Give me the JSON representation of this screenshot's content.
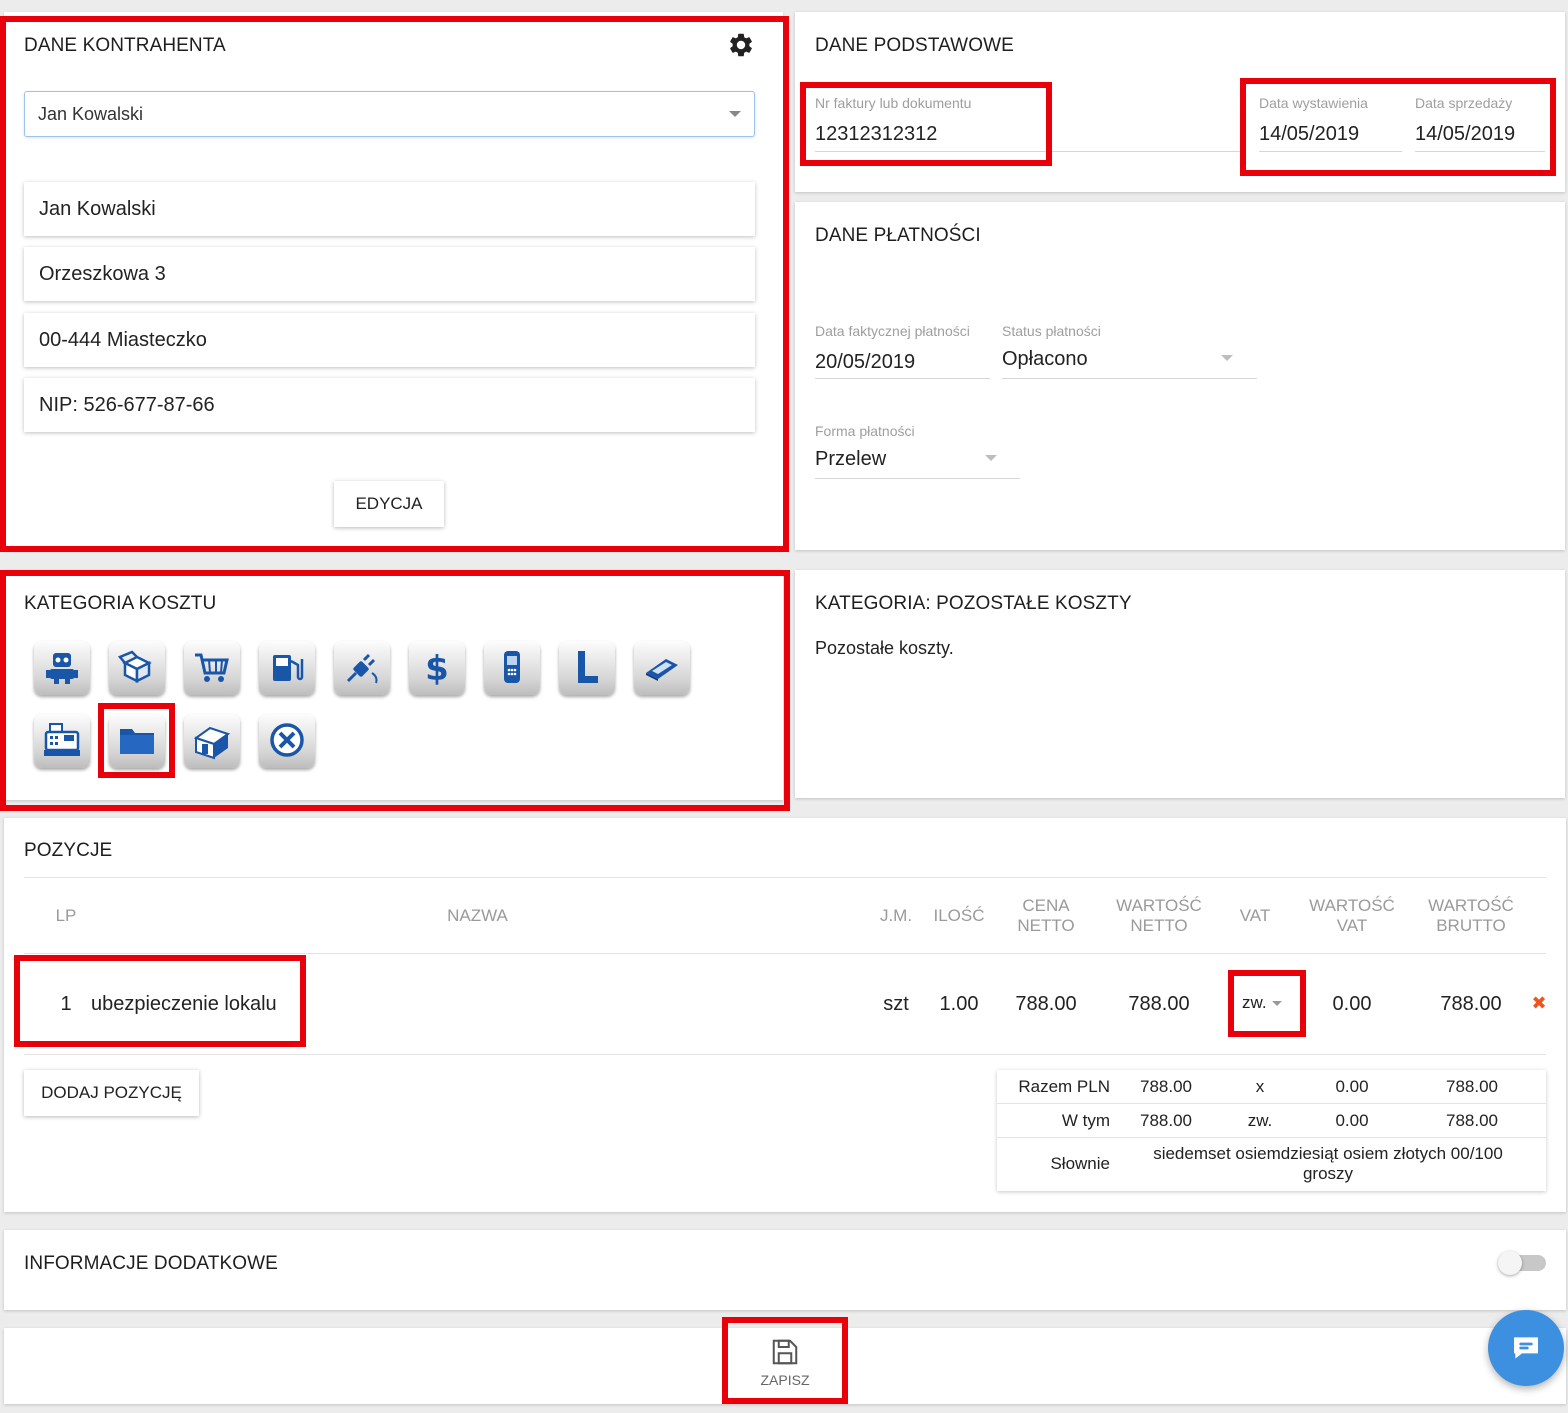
{
  "kontrahent": {
    "title": "DANE KONTRAHENTA",
    "selected": "Jan Kowalski",
    "name": "Jan Kowalski",
    "street": "Orzeszkowa 3",
    "city": "00-444 Miasteczko",
    "nip": "NIP: 526-677-87-66",
    "edit_label": "EDYCJA"
  },
  "podstawowe": {
    "title": "DANE PODSTAWOWE",
    "nr_label": "Nr faktury lub dokumentu",
    "nr_value": "12312312312",
    "wyst_label": "Data wystawienia",
    "wyst_value": "14/05/2019",
    "sprzed_label": "Data sprzedaży",
    "sprzed_value": "14/05/2019"
  },
  "platnosci": {
    "title": "DANE PŁATNOŚCI",
    "data_label": "Data faktycznej płatności",
    "data_value": "20/05/2019",
    "status_label": "Status płatności",
    "status_value": "Opłacono",
    "forma_label": "Forma płatności",
    "forma_value": "Przelew"
  },
  "kategoria": {
    "title": "KATEGORIA KOSZTU",
    "icons": [
      "robot-icon",
      "box-icon",
      "cart-icon",
      "fuel-icon",
      "plug-icon",
      "dollar-icon",
      "phone-icon",
      "letter-l-icon",
      "calculator-icon",
      "cash-register-icon",
      "folder-icon",
      "house-icon",
      "cancel-icon"
    ],
    "icon_color": "#1a56a8"
  },
  "kategoria_info": {
    "title": "KATEGORIA: POZOSTAŁE KOSZTY",
    "description": "Pozostałe koszty."
  },
  "pozycje": {
    "title": "POZYCJE",
    "headers": {
      "lp": "LP",
      "nazwa": "NAZWA",
      "jm": "J.M.",
      "ilosc": "ILOŚĆ",
      "cena_1": "CENA",
      "cena_2": "NETTO",
      "wn_1": "WARTOŚĆ",
      "wn_2": "NETTO",
      "vat": "VAT",
      "wv_1": "WARTOŚĆ",
      "wv_2": "VAT",
      "wb_1": "WARTOŚĆ",
      "wb_2": "BRUTTO"
    },
    "rows": [
      {
        "lp": "1",
        "nazwa": "ubezpieczenie lokalu",
        "jm": "szt",
        "ilosc": "1.00",
        "cena": "788.00",
        "wartosc_netto": "788.00",
        "vat": "zw.",
        "wartosc_vat": "0.00",
        "wartosc_brutto": "788.00",
        "delete": "✖"
      }
    ],
    "add_label": "DODAJ POZYCJĘ",
    "summary": {
      "razem_label": "Razem PLN",
      "razem_netto": "788.00",
      "razem_vat": "x",
      "razem_vat_val": "0.00",
      "razem_brutto": "788.00",
      "wtym_label": "W tym",
      "wtym_netto": "788.00",
      "wtym_vat": "zw.",
      "wtym_vat_val": "0.00",
      "wtym_brutto": "788.00",
      "slownie_label": "Słownie",
      "slownie_value": "siedemset osiemdziesiąt osiem złotych 00/100 groszy"
    }
  },
  "dodatkowe": {
    "title": "INFORMACJE DODATKOWE"
  },
  "footer": {
    "save_label": "ZAPISZ"
  },
  "colors": {
    "highlight": "#e8000b",
    "chat": "#3d8fe0",
    "delete": "#f0541e"
  }
}
